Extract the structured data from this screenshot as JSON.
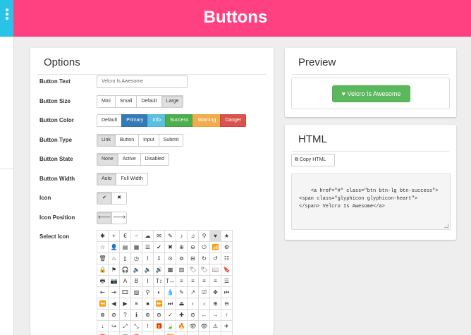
{
  "header": {
    "title": "Buttons"
  },
  "options": {
    "title": "Options",
    "rows": {
      "text": {
        "label": "Button Text",
        "value": "Velcro Is Awesome"
      },
      "size": {
        "label": "Button Size",
        "items": [
          "Mini",
          "Small",
          "Default",
          "Large"
        ],
        "selected": "Large"
      },
      "color": {
        "label": "Button Color",
        "items": [
          "Default",
          "Primary",
          "Info",
          "Success",
          "Warning",
          "Danger"
        ]
      },
      "type": {
        "label": "Button Type",
        "items": [
          "Link",
          "Button",
          "Input",
          "Submit"
        ],
        "selected": "Link"
      },
      "state": {
        "label": "Button State",
        "items": [
          "None",
          "Active",
          "Disabled"
        ],
        "selected": "None"
      },
      "width": {
        "label": "Button Width",
        "items": [
          "Auto",
          "Full Width"
        ],
        "selected": "Auto"
      },
      "icon": {
        "label": "Icon",
        "yes": "✔",
        "no": "✖"
      },
      "position": {
        "label": "Icon Position",
        "left": "🡐",
        "right": "🡒"
      },
      "select_icon": {
        "label": "Select Icon"
      }
    },
    "icons": [
      "✱",
      "+",
      "€",
      "−",
      "☁",
      "✉",
      "✎",
      "♪",
      "♫",
      "⚲",
      "♥",
      "★",
      "☆",
      "👤",
      "▤",
      "▦",
      "☰",
      "✔",
      "✖",
      "⊕",
      "⊖",
      "⏻",
      "📶",
      "⚙",
      "🗑",
      "⌂",
      "▯",
      "◷",
      "⌇",
      "⇩",
      "⊙",
      "⊚",
      "⊟",
      "↻",
      "↺",
      "☷",
      "🔒",
      "⚑",
      "🎧",
      "🔈",
      "🔉",
      "🔊",
      "▩",
      "▥",
      "🏷",
      "🏷",
      "📖",
      "🔖",
      "🖶",
      "📷",
      "A",
      "B",
      "I",
      "T↕",
      "T↔",
      "≡",
      "≡",
      "≡",
      "≡",
      "☰",
      "⇤",
      "⇥",
      "🎞",
      "▨",
      "⚲",
      "◐",
      "💧",
      "✎",
      "↗",
      "☑",
      "✥",
      "⏮",
      "⏪",
      "◀",
      "▶",
      "⏸",
      "⏹",
      "⏩",
      "⏭",
      "⏏",
      "‹",
      "›",
      "⊕",
      "⊖",
      "⊗",
      "⊘",
      "?",
      "ℹ",
      "⊛",
      "⊖",
      "✓",
      "✚",
      "⊝",
      "←",
      "→",
      "↑",
      "↓",
      "↪",
      "⤢",
      "⤡",
      "!",
      "🎁",
      "🍃",
      "🔥",
      "👁",
      "👁",
      "⚠",
      "✈",
      "📅",
      "⤨",
      "💬",
      "🧲",
      "⌃",
      "⌄",
      "🔁",
      "🛒",
      "📁",
      "📂",
      "⇕",
      "⇔"
    ],
    "selected_icon_index": 10
  },
  "preview": {
    "title": "Preview",
    "button_label": "Velcro Is Awesome"
  },
  "html": {
    "title": "HTML",
    "copy_label": "Copy HTML",
    "code": "<a href=\"#\" class=\"btn btn-lg btn-success\">\n<span class=\"glyphicon glyphicon-heart\">\n</span> Velcro Is Awesome</a>"
  },
  "colors": {
    "header": "#ff4081",
    "toggle": "#29c3e8",
    "default": "#ffffff",
    "primary": "#337ab7",
    "info": "#5bc0de",
    "success": "#5cb85c",
    "warning": "#f0ad4e",
    "danger": "#d9534f"
  }
}
